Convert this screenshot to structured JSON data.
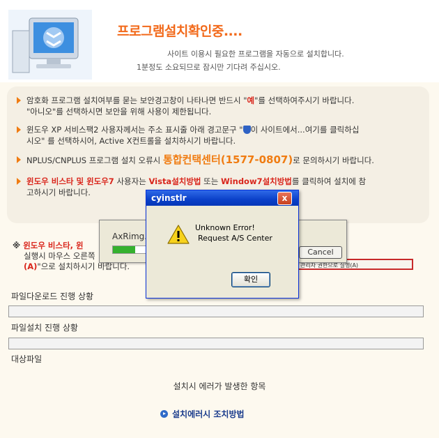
{
  "header": {
    "title": "프로그램설치확인중....",
    "subtitle1": "사이트 이용시 필요한 프로그램을 자동으로 설치합니다.",
    "subtitle2": "1분정도 소요되므로 잠시만 기다려 주십시오."
  },
  "notice": {
    "item1_a": "암호화 프로그램 설치여부를 묻는 보안경고창이 나타나면 반드시 \"",
    "item1_yes": "예",
    "item1_b": "\"를 선택하여주시기 바랍니다.",
    "item1_c": "\"아니오\"를 선택하시면 보안을 위해 사용이 제한됩니다.",
    "item2_a": "윈도우 XP 서비스팩2 사용자께서는 주소 표시줄 아래 경고문구 \"",
    "item2_b": "이 사이트에서...여기를 클릭하십",
    "item2_c": "시오\" 를 선택하시어, Active X컨트롤을 설치하시기 바랍니다.",
    "item3_a": "NPLUS/CNPLUS 프로그램 설치 오류시 ",
    "item3_center": "통합컨택센터(1577-0807)",
    "item3_b": "로 문의하시기 바랍니다.",
    "item4_red1": "윈도우 비스타 및 윈도우7",
    "item4_a": " 사용자는 ",
    "item4_red2": "Vista설치방법",
    "item4_b": " 또는 ",
    "item4_red3": "Window7설치방법",
    "item4_c": "를 클릭하여 설치에 참",
    "item4_d": "고하시기 바랍니다."
  },
  "lower": {
    "note_mark": "※ ",
    "note_red": "윈도우 비스타, 윈",
    "note_line2": "실행시 마우스 오른쪽",
    "note_line3_red": "(A)",
    "note_line3": "\"으로 설치하시기 바랍니다.",
    "context_menu_text": "관리자 권한으로 실행(A)",
    "download_label": "파일다운로드 진행 상황",
    "install_label": "파일설치 진행 상황",
    "target_label": "대상파일",
    "error_header": "설치시 에러가 발생한 항목",
    "error_link": "설치에러시 조치방법"
  },
  "bg_dialog": {
    "title": "AxRimg.C",
    "cancel": "Cancel",
    "progress": 0.35
  },
  "dialog": {
    "title": "cyinstlr",
    "close": "x",
    "message1": "Unknown Error!",
    "message2": "Request A/S Center",
    "ok": "확인"
  },
  "colors": {
    "accent": "#f26a1b",
    "red": "#d9261c",
    "titlebar": "#0a40c8"
  }
}
